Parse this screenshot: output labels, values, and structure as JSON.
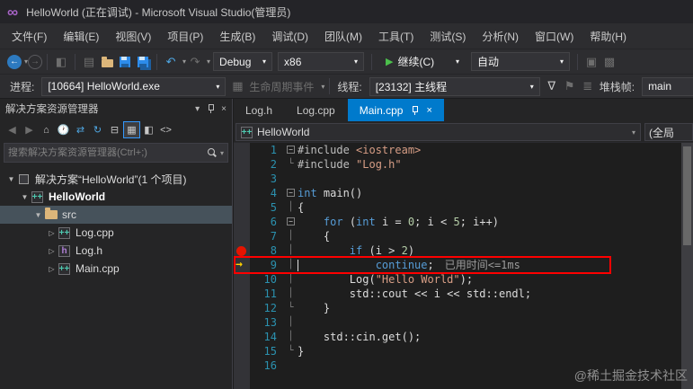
{
  "window": {
    "title": "HelloWorld (正在调试) - Microsoft Visual Studio(管理员)"
  },
  "menu": [
    "文件(F)",
    "编辑(E)",
    "视图(V)",
    "项目(P)",
    "生成(B)",
    "调试(D)",
    "团队(M)",
    "工具(T)",
    "测试(S)",
    "分析(N)",
    "窗口(W)",
    "帮助(H)"
  ],
  "toolbar1": {
    "debug_config": "Debug",
    "platform": "x86",
    "continue_label": "继续(C)",
    "auto_label": "自动"
  },
  "toolbar2": {
    "process_label": "进程:",
    "process_value": "[10664] HelloWorld.exe",
    "lifecycle_label": "生命周期事件",
    "thread_label": "线程:",
    "thread_value": "[23132] 主线程",
    "stack_label": "堆栈帧:",
    "stack_value": "main"
  },
  "solution_explorer": {
    "title": "解决方案资源管理器",
    "search_placeholder": "搜索解决方案资源管理器(Ctrl+;)",
    "tree": [
      {
        "label": "解决方案“HelloWorld”(1 个项目)",
        "indent": 0,
        "expanded": true,
        "icon": "solution",
        "bold": false,
        "selected": false
      },
      {
        "label": "HelloWorld",
        "indent": 1,
        "expanded": true,
        "icon": "cpp-project",
        "bold": true,
        "selected": false
      },
      {
        "label": "src",
        "indent": 2,
        "expanded": true,
        "icon": "folder",
        "bold": false,
        "selected": true
      },
      {
        "label": "Log.cpp",
        "indent": 3,
        "expanded": false,
        "icon": "cpp-file",
        "bold": false,
        "selected": false
      },
      {
        "label": "Log.h",
        "indent": 3,
        "expanded": false,
        "icon": "h-file",
        "bold": false,
        "selected": false
      },
      {
        "label": "Main.cpp",
        "indent": 3,
        "expanded": false,
        "icon": "cpp-file",
        "bold": false,
        "selected": false
      }
    ]
  },
  "editor": {
    "tabs": [
      {
        "label": "Log.h",
        "active": false
      },
      {
        "label": "Log.cpp",
        "active": false
      },
      {
        "label": "Main.cpp",
        "active": true
      }
    ],
    "navbar": {
      "scope": "HelloWorld",
      "right_scope": "(全局"
    },
    "breakpoint_line": 8,
    "current_line": 9,
    "perftip": "已用时间<=1ms",
    "lines": [
      {
        "n": 1,
        "fold": "box",
        "tokens": [
          {
            "t": "#include ",
            "c": "pp"
          },
          {
            "t": "<iostream>",
            "c": "str"
          }
        ]
      },
      {
        "n": 2,
        "fold": "end",
        "tokens": [
          {
            "t": "#include ",
            "c": "pp"
          },
          {
            "t": "\"Log.h\"",
            "c": "str"
          }
        ]
      },
      {
        "n": 3,
        "fold": "",
        "tokens": []
      },
      {
        "n": 4,
        "fold": "box",
        "tokens": [
          {
            "t": "int",
            "c": "kw"
          },
          {
            "t": " main()",
            "c": "pl"
          }
        ]
      },
      {
        "n": 5,
        "fold": "v",
        "tokens": [
          {
            "t": "{",
            "c": "pl"
          }
        ]
      },
      {
        "n": 6,
        "fold": "box",
        "tokens": [
          {
            "t": "    ",
            "c": "pl"
          },
          {
            "t": "for",
            "c": "kw"
          },
          {
            "t": " (",
            "c": "pl"
          },
          {
            "t": "int",
            "c": "kw"
          },
          {
            "t": " i = ",
            "c": "pl"
          },
          {
            "t": "0",
            "c": "num"
          },
          {
            "t": "; i < ",
            "c": "pl"
          },
          {
            "t": "5",
            "c": "num"
          },
          {
            "t": "; i++)",
            "c": "pl"
          }
        ]
      },
      {
        "n": 7,
        "fold": "v",
        "tokens": [
          {
            "t": "    {",
            "c": "pl"
          }
        ]
      },
      {
        "n": 8,
        "fold": "v",
        "tokens": [
          {
            "t": "        ",
            "c": "pl"
          },
          {
            "t": "if",
            "c": "kw"
          },
          {
            "t": " (i > ",
            "c": "pl"
          },
          {
            "t": "2",
            "c": "num"
          },
          {
            "t": ")",
            "c": "pl"
          }
        ]
      },
      {
        "n": 9,
        "fold": "v",
        "tokens": [
          {
            "t": "            ",
            "c": "pl"
          },
          {
            "t": "continue",
            "c": "kw"
          },
          {
            "t": ";",
            "c": "pl"
          }
        ]
      },
      {
        "n": 10,
        "fold": "v",
        "tokens": [
          {
            "t": "        Log(",
            "c": "pl"
          },
          {
            "t": "\"Hello World\"",
            "c": "str"
          },
          {
            "t": ");",
            "c": "pl"
          }
        ]
      },
      {
        "n": 11,
        "fold": "v",
        "tokens": [
          {
            "t": "        std::cout << i << std::endl;",
            "c": "pl"
          }
        ]
      },
      {
        "n": 12,
        "fold": "end",
        "tokens": [
          {
            "t": "    }",
            "c": "pl"
          }
        ]
      },
      {
        "n": 13,
        "fold": "v",
        "tokens": []
      },
      {
        "n": 14,
        "fold": "v",
        "tokens": [
          {
            "t": "    std::cin.get();",
            "c": "pl"
          }
        ]
      },
      {
        "n": 15,
        "fold": "end",
        "tokens": [
          {
            "t": "}",
            "c": "pl"
          }
        ]
      },
      {
        "n": 16,
        "fold": "",
        "tokens": []
      }
    ]
  },
  "watermark": "@稀土掘金技术社区",
  "colors": {
    "accent": "#007ACC",
    "breakpoint": "#E51400",
    "execution_arrow": "#FFD100",
    "annotation_box": "#FF0000",
    "selection": "#46525B"
  }
}
